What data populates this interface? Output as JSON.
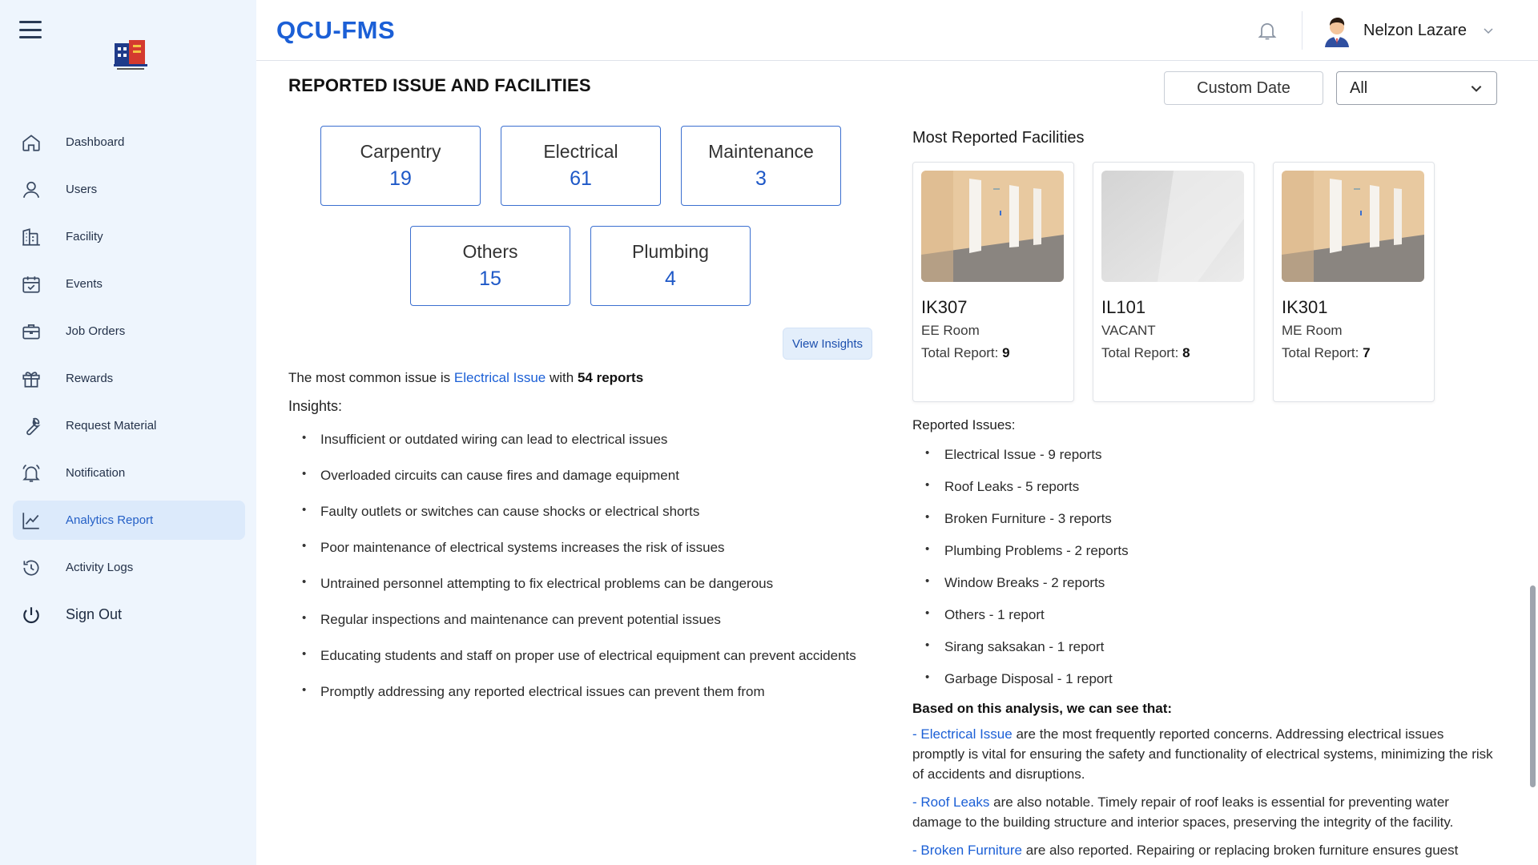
{
  "app": {
    "brand": "QCU-FMS"
  },
  "user": {
    "name": "Nelzon Lazare"
  },
  "sidebar": {
    "items": [
      {
        "label": "Dashboard",
        "icon": "home-icon"
      },
      {
        "label": "Users",
        "icon": "user-icon"
      },
      {
        "label": "Facility",
        "icon": "building-icon"
      },
      {
        "label": "Events",
        "icon": "calendar-check-icon"
      },
      {
        "label": "Job Orders",
        "icon": "briefcase-icon"
      },
      {
        "label": "Rewards",
        "icon": "gift-icon"
      },
      {
        "label": "Request Material",
        "icon": "wrench-icon"
      },
      {
        "label": "Notification",
        "icon": "bell-icon"
      },
      {
        "label": "Analytics Report",
        "icon": "chart-line-icon",
        "active": true
      },
      {
        "label": "Activity Logs",
        "icon": "history-icon"
      }
    ],
    "signout": {
      "label": "Sign Out",
      "icon": "power-icon"
    }
  },
  "page": {
    "title": "REPORTED ISSUE AND FACILITIES",
    "custom_date_label": "Custom Date",
    "filter_value": "All"
  },
  "categories": [
    {
      "name": "Carpentry",
      "count": "19"
    },
    {
      "name": "Electrical",
      "count": "61"
    },
    {
      "name": "Maintenance",
      "count": "3"
    },
    {
      "name": "Others",
      "count": "15"
    },
    {
      "name": "Plumbing",
      "count": "4"
    }
  ],
  "view_insights_label": "View Insights",
  "summary": {
    "prefix": "The most common issue is",
    "issue": "Electrical Issue",
    "middle": "with",
    "reports": "54 reports"
  },
  "insights": {
    "heading": "Insights:",
    "items": [
      "Insufficient or outdated wiring can lead to electrical issues",
      "Overloaded circuits can cause fires and damage equipment",
      "Faulty outlets or switches can cause shocks or electrical shorts",
      "Poor maintenance of electrical systems increases the risk of issues",
      "Untrained personnel attempting to fix electrical problems can be dangerous",
      "Regular inspections and maintenance can prevent potential issues",
      "Educating students and staff on proper use of electrical equipment can prevent accidents",
      "Promptly addressing any reported electrical issues can prevent them from"
    ]
  },
  "most_reported": {
    "title": "Most Reported Facilities",
    "total_label": "Total Report:",
    "facilities": [
      {
        "code": "IK307",
        "type": "EE Room",
        "total": "9"
      },
      {
        "code": "IL101",
        "type": "VACANT",
        "total": "8"
      },
      {
        "code": "IK301",
        "type": "ME Room",
        "total": "7"
      }
    ]
  },
  "reported_issues": {
    "heading": "Reported Issues:",
    "items": [
      "Electrical Issue - 9 reports",
      "Roof Leaks - 5 reports",
      "Broken Furniture - 3 reports",
      "Plumbing Problems - 2 reports",
      "Window Breaks - 2 reports",
      "Others - 1 report",
      "Sirang saksakan - 1 report",
      "Garbage Disposal - 1 report"
    ]
  },
  "analysis": {
    "heading": "Based on this analysis, we can see that:",
    "paragraphs": [
      {
        "dash": "- ",
        "term": "Electrical Issue",
        "text": " are the most frequently reported concerns. Addressing electrical issues promptly is vital for ensuring the safety and functionality of electrical systems, minimizing the risk of accidents and disruptions."
      },
      {
        "dash": "- ",
        "term": "Roof Leaks",
        "text": " are also notable. Timely repair of roof leaks is essential for preventing water damage to the building structure and interior spaces, preserving the integrity of the facility."
      },
      {
        "dash": "- ",
        "term": "Broken Furniture",
        "text": " are also reported. Repairing or replacing broken furniture ensures guest"
      }
    ]
  }
}
